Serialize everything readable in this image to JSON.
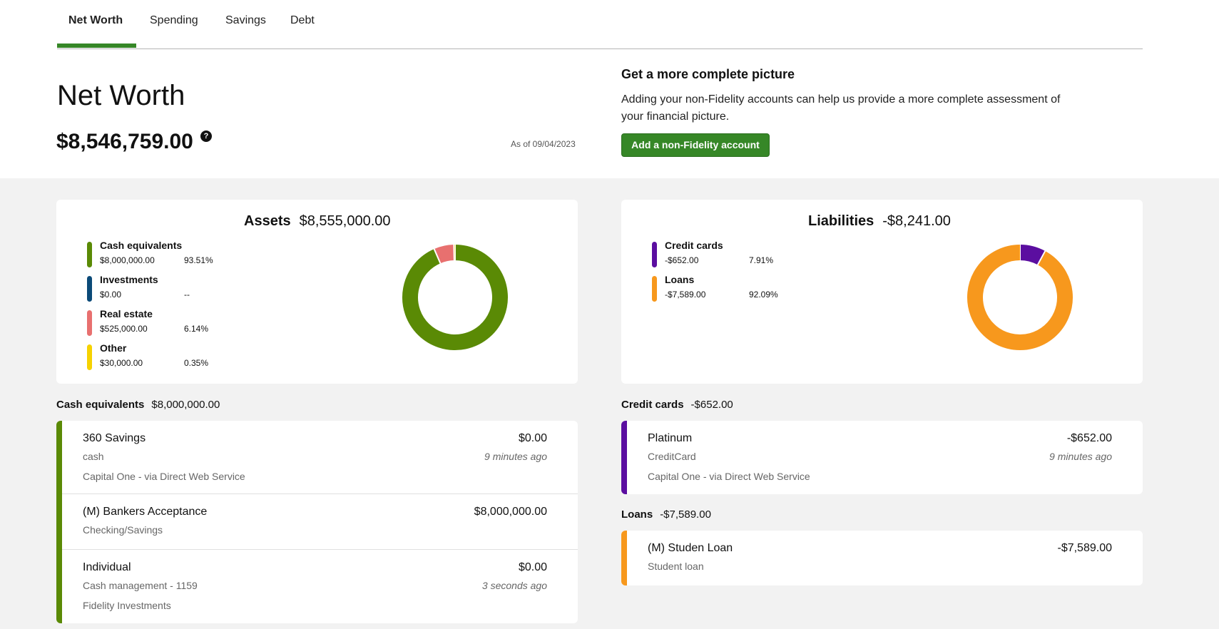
{
  "tabs": [
    {
      "label": "Net Worth",
      "active": true
    },
    {
      "label": "Spending"
    },
    {
      "label": "Savings"
    },
    {
      "label": "Debt"
    }
  ],
  "header": {
    "title": "Net Worth",
    "value": "$8,546,759.00",
    "help_glyph": "?",
    "as_of": "As of 09/04/2023"
  },
  "promo": {
    "title": "Get a more complete picture",
    "text": "Adding your non-Fidelity accounts can help us provide a more complete assessment of your financial picture.",
    "button_label": "Add a non-Fidelity account"
  },
  "colors": {
    "accent_green": "#368727",
    "cash": "#5a8a05",
    "investments": "#0b4a78",
    "real_estate": "#e8706f",
    "other": "#f6d200",
    "credit_cards": "#5b0ea0",
    "loans": "#f7981d"
  },
  "assets": {
    "label": "Assets",
    "total": "$8,555,000.00",
    "legend": [
      {
        "name": "Cash equivalents",
        "value": "$8,000,000.00",
        "pct": "93.51%",
        "color": "#5a8a05"
      },
      {
        "name": "Investments",
        "value": "$0.00",
        "pct": "--",
        "color": "#0b4a78"
      },
      {
        "name": "Real estate",
        "value": "$525,000.00",
        "pct": "6.14%",
        "color": "#e8706f"
      },
      {
        "name": "Other",
        "value": "$30,000.00",
        "pct": "0.35%",
        "color": "#f6d200"
      }
    ]
  },
  "liabilities": {
    "label": "Liabilities",
    "total": "-$8,241.00",
    "legend": [
      {
        "name": "Credit cards",
        "value": "-$652.00",
        "pct": "7.91%",
        "color": "#5b0ea0"
      },
      {
        "name": "Loans",
        "value": "-$7,589.00",
        "pct": "92.09%",
        "color": "#f7981d"
      }
    ]
  },
  "chart_data": [
    {
      "type": "pie",
      "title": "Assets",
      "categories": [
        "Cash equivalents",
        "Investments",
        "Real estate",
        "Other"
      ],
      "values": [
        93.51,
        0,
        6.14,
        0.35
      ],
      "colors": [
        "#5a8a05",
        "#0b4a78",
        "#e8706f",
        "#f6d200"
      ]
    },
    {
      "type": "pie",
      "title": "Liabilities",
      "categories": [
        "Credit cards",
        "Loans"
      ],
      "values": [
        7.91,
        92.09
      ],
      "colors": [
        "#5b0ea0",
        "#f7981d"
      ]
    }
  ],
  "cash_section": {
    "label": "Cash equivalents",
    "total": "$8,000,000.00",
    "accounts": [
      {
        "name": "360 Savings",
        "type": "cash",
        "institution": "Capital One - via Direct Web Service",
        "balance": "$0.00",
        "updated": "9 minutes ago"
      },
      {
        "name": "(M) Bankers Acceptance",
        "type": "Checking/Savings",
        "balance": "$8,000,000.00"
      },
      {
        "name": "Individual",
        "type": "Cash management - 1159",
        "institution": "Fidelity Investments",
        "balance": "$0.00",
        "updated": "3 seconds ago"
      }
    ]
  },
  "credit_section": {
    "label": "Credit cards",
    "total": "-$652.00",
    "accounts": [
      {
        "name": "Platinum",
        "type": "CreditCard",
        "institution": "Capital One - via Direct Web Service",
        "balance": "-$652.00",
        "updated": "9 minutes ago"
      }
    ]
  },
  "loans_section": {
    "label": "Loans",
    "total": "-$7,589.00",
    "accounts": [
      {
        "name": "(M) Studen Loan",
        "type": "Student loan",
        "balance": "-$7,589.00"
      }
    ]
  }
}
